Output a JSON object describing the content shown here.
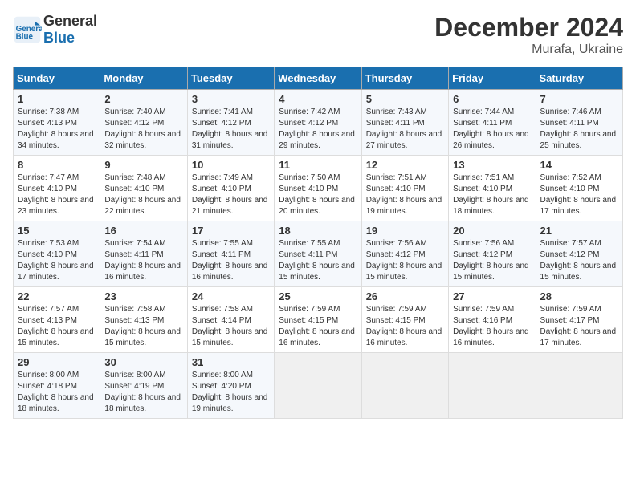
{
  "header": {
    "logo_line1": "General",
    "logo_line2": "Blue",
    "month": "December 2024",
    "location": "Murafa, Ukraine"
  },
  "days_of_week": [
    "Sunday",
    "Monday",
    "Tuesday",
    "Wednesday",
    "Thursday",
    "Friday",
    "Saturday"
  ],
  "weeks": [
    [
      {
        "day": "1",
        "sunrise": "Sunrise: 7:38 AM",
        "sunset": "Sunset: 4:13 PM",
        "daylight": "Daylight: 8 hours and 34 minutes."
      },
      {
        "day": "2",
        "sunrise": "Sunrise: 7:40 AM",
        "sunset": "Sunset: 4:12 PM",
        "daylight": "Daylight: 8 hours and 32 minutes."
      },
      {
        "day": "3",
        "sunrise": "Sunrise: 7:41 AM",
        "sunset": "Sunset: 4:12 PM",
        "daylight": "Daylight: 8 hours and 31 minutes."
      },
      {
        "day": "4",
        "sunrise": "Sunrise: 7:42 AM",
        "sunset": "Sunset: 4:12 PM",
        "daylight": "Daylight: 8 hours and 29 minutes."
      },
      {
        "day": "5",
        "sunrise": "Sunrise: 7:43 AM",
        "sunset": "Sunset: 4:11 PM",
        "daylight": "Daylight: 8 hours and 27 minutes."
      },
      {
        "day": "6",
        "sunrise": "Sunrise: 7:44 AM",
        "sunset": "Sunset: 4:11 PM",
        "daylight": "Daylight: 8 hours and 26 minutes."
      },
      {
        "day": "7",
        "sunrise": "Sunrise: 7:46 AM",
        "sunset": "Sunset: 4:11 PM",
        "daylight": "Daylight: 8 hours and 25 minutes."
      }
    ],
    [
      {
        "day": "8",
        "sunrise": "Sunrise: 7:47 AM",
        "sunset": "Sunset: 4:10 PM",
        "daylight": "Daylight: 8 hours and 23 minutes."
      },
      {
        "day": "9",
        "sunrise": "Sunrise: 7:48 AM",
        "sunset": "Sunset: 4:10 PM",
        "daylight": "Daylight: 8 hours and 22 minutes."
      },
      {
        "day": "10",
        "sunrise": "Sunrise: 7:49 AM",
        "sunset": "Sunset: 4:10 PM",
        "daylight": "Daylight: 8 hours and 21 minutes."
      },
      {
        "day": "11",
        "sunrise": "Sunrise: 7:50 AM",
        "sunset": "Sunset: 4:10 PM",
        "daylight": "Daylight: 8 hours and 20 minutes."
      },
      {
        "day": "12",
        "sunrise": "Sunrise: 7:51 AM",
        "sunset": "Sunset: 4:10 PM",
        "daylight": "Daylight: 8 hours and 19 minutes."
      },
      {
        "day": "13",
        "sunrise": "Sunrise: 7:51 AM",
        "sunset": "Sunset: 4:10 PM",
        "daylight": "Daylight: 8 hours and 18 minutes."
      },
      {
        "day": "14",
        "sunrise": "Sunrise: 7:52 AM",
        "sunset": "Sunset: 4:10 PM",
        "daylight": "Daylight: 8 hours and 17 minutes."
      }
    ],
    [
      {
        "day": "15",
        "sunrise": "Sunrise: 7:53 AM",
        "sunset": "Sunset: 4:10 PM",
        "daylight": "Daylight: 8 hours and 17 minutes."
      },
      {
        "day": "16",
        "sunrise": "Sunrise: 7:54 AM",
        "sunset": "Sunset: 4:11 PM",
        "daylight": "Daylight: 8 hours and 16 minutes."
      },
      {
        "day": "17",
        "sunrise": "Sunrise: 7:55 AM",
        "sunset": "Sunset: 4:11 PM",
        "daylight": "Daylight: 8 hours and 16 minutes."
      },
      {
        "day": "18",
        "sunrise": "Sunrise: 7:55 AM",
        "sunset": "Sunset: 4:11 PM",
        "daylight": "Daylight: 8 hours and 15 minutes."
      },
      {
        "day": "19",
        "sunrise": "Sunrise: 7:56 AM",
        "sunset": "Sunset: 4:12 PM",
        "daylight": "Daylight: 8 hours and 15 minutes."
      },
      {
        "day": "20",
        "sunrise": "Sunrise: 7:56 AM",
        "sunset": "Sunset: 4:12 PM",
        "daylight": "Daylight: 8 hours and 15 minutes."
      },
      {
        "day": "21",
        "sunrise": "Sunrise: 7:57 AM",
        "sunset": "Sunset: 4:12 PM",
        "daylight": "Daylight: 8 hours and 15 minutes."
      }
    ],
    [
      {
        "day": "22",
        "sunrise": "Sunrise: 7:57 AM",
        "sunset": "Sunset: 4:13 PM",
        "daylight": "Daylight: 8 hours and 15 minutes."
      },
      {
        "day": "23",
        "sunrise": "Sunrise: 7:58 AM",
        "sunset": "Sunset: 4:13 PM",
        "daylight": "Daylight: 8 hours and 15 minutes."
      },
      {
        "day": "24",
        "sunrise": "Sunrise: 7:58 AM",
        "sunset": "Sunset: 4:14 PM",
        "daylight": "Daylight: 8 hours and 15 minutes."
      },
      {
        "day": "25",
        "sunrise": "Sunrise: 7:59 AM",
        "sunset": "Sunset: 4:15 PM",
        "daylight": "Daylight: 8 hours and 16 minutes."
      },
      {
        "day": "26",
        "sunrise": "Sunrise: 7:59 AM",
        "sunset": "Sunset: 4:15 PM",
        "daylight": "Daylight: 8 hours and 16 minutes."
      },
      {
        "day": "27",
        "sunrise": "Sunrise: 7:59 AM",
        "sunset": "Sunset: 4:16 PM",
        "daylight": "Daylight: 8 hours and 16 minutes."
      },
      {
        "day": "28",
        "sunrise": "Sunrise: 7:59 AM",
        "sunset": "Sunset: 4:17 PM",
        "daylight": "Daylight: 8 hours and 17 minutes."
      }
    ],
    [
      {
        "day": "29",
        "sunrise": "Sunrise: 8:00 AM",
        "sunset": "Sunset: 4:18 PM",
        "daylight": "Daylight: 8 hours and 18 minutes."
      },
      {
        "day": "30",
        "sunrise": "Sunrise: 8:00 AM",
        "sunset": "Sunset: 4:19 PM",
        "daylight": "Daylight: 8 hours and 18 minutes."
      },
      {
        "day": "31",
        "sunrise": "Sunrise: 8:00 AM",
        "sunset": "Sunset: 4:20 PM",
        "daylight": "Daylight: 8 hours and 19 minutes."
      },
      null,
      null,
      null,
      null
    ]
  ]
}
